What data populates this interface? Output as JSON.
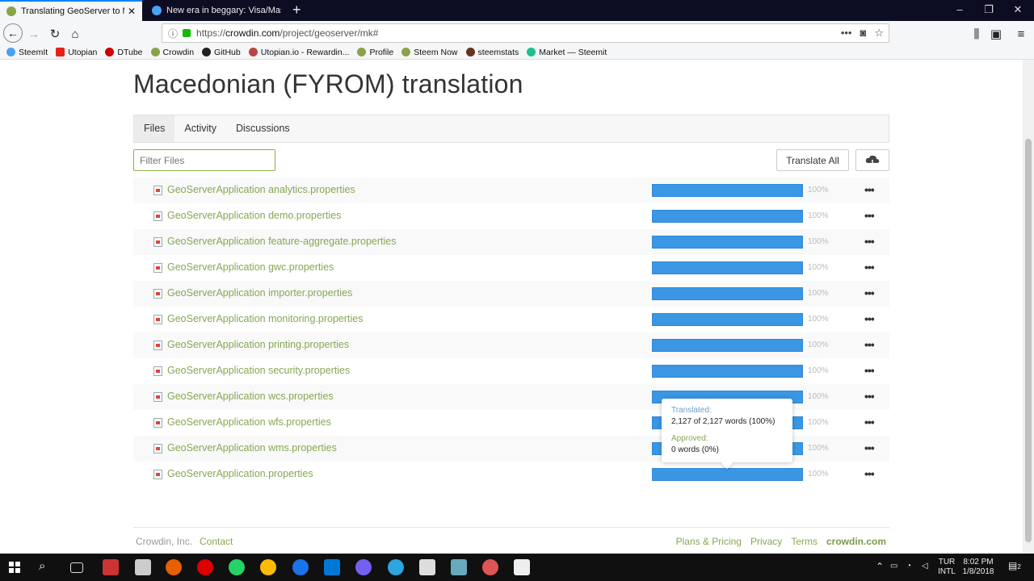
{
  "browser": {
    "tabs": [
      {
        "title": "Translating GeoServer to Macedonian",
        "active": true
      },
      {
        "title": "New era in beggary: Visa/Mastercard",
        "active": false
      }
    ],
    "url_prefix": "https://",
    "url_domain": "crowdin.com",
    "url_path": "/project/geoserver/mk#",
    "bookmarks": [
      "SteemIt",
      "Utopian",
      "DTube",
      "Crowdin",
      "GitHub",
      "Utopian.io - Rewardin...",
      "Profile",
      "Steem Now",
      "steemstats",
      "Market — Steemit"
    ]
  },
  "page": {
    "title": "Macedonian (FYROM) translation",
    "tabs": [
      "Files",
      "Activity",
      "Discussions"
    ],
    "filter_placeholder": "Filter Files",
    "translate_all_label": "Translate All",
    "files": [
      {
        "name": "GeoServerApplication analytics.properties",
        "progress": "100%"
      },
      {
        "name": "GeoServerApplication demo.properties",
        "progress": "100%"
      },
      {
        "name": "GeoServerApplication feature-aggregate.properties",
        "progress": "100%"
      },
      {
        "name": "GeoServerApplication gwc.properties",
        "progress": "100%"
      },
      {
        "name": "GeoServerApplication importer.properties",
        "progress": "100%"
      },
      {
        "name": "GeoServerApplication monitoring.properties",
        "progress": "100%"
      },
      {
        "name": "GeoServerApplication printing.properties",
        "progress": "100%"
      },
      {
        "name": "GeoServerApplication security.properties",
        "progress": "100%"
      },
      {
        "name": "GeoServerApplication wcs.properties",
        "progress": "100%"
      },
      {
        "name": "GeoServerApplication wfs.properties",
        "progress": "100%"
      },
      {
        "name": "GeoServerApplication wms.properties",
        "progress": "100%"
      },
      {
        "name": "GeoServerApplication.properties",
        "progress": "100%"
      }
    ],
    "tooltip": {
      "translated_label": "Translated:",
      "translated_value": "2,127 of 2,127 words (100%)",
      "approved_label": "Approved:",
      "approved_value": "0 words (0%)"
    },
    "footer": {
      "company": "Crowdin, Inc.",
      "contact": "Contact",
      "links": [
        "Plans & Pricing",
        "Privacy",
        "Terms"
      ],
      "brand": "crowdin.com"
    }
  },
  "taskbar": {
    "lang_top": "TUR",
    "lang_bottom": "INTL",
    "time": "8:02 PM",
    "date": "1/8/2018",
    "notification_count": "2"
  },
  "colors": {
    "accent_green": "#86a754",
    "progress_blue": "#3b97e3",
    "tab_active_border": "#0a84ff"
  }
}
